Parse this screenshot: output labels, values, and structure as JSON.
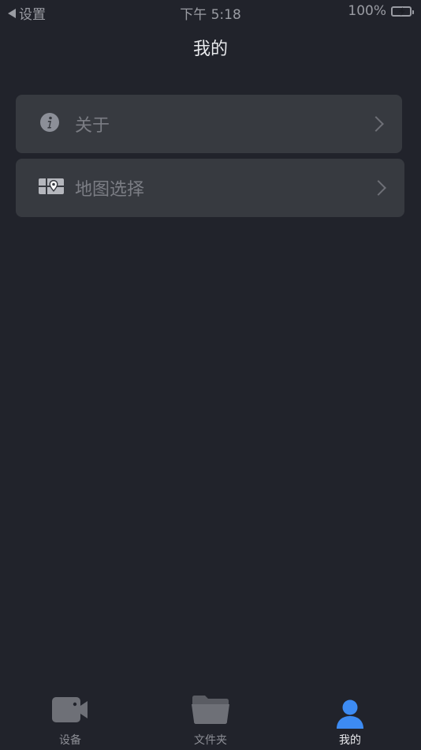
{
  "status_bar": {
    "back_label": "设置",
    "time": "下午 5:18",
    "battery_percent": "100%",
    "battery_level": 1.0,
    "battery_color": "#3bc24f"
  },
  "nav": {
    "title": "我的"
  },
  "menu": {
    "items": [
      {
        "label": "关于",
        "icon": "info-icon"
      },
      {
        "label": "地图选择",
        "icon": "map-icon"
      }
    ]
  },
  "tab_bar": {
    "tabs": [
      {
        "label": "设备",
        "icon": "video-camera-icon",
        "active": false
      },
      {
        "label": "文件夹",
        "icon": "folder-icon",
        "active": false
      },
      {
        "label": "我的",
        "icon": "person-icon",
        "active": true
      }
    ],
    "active_color": "#3d8bf2",
    "inactive_color": "#6e7077"
  }
}
